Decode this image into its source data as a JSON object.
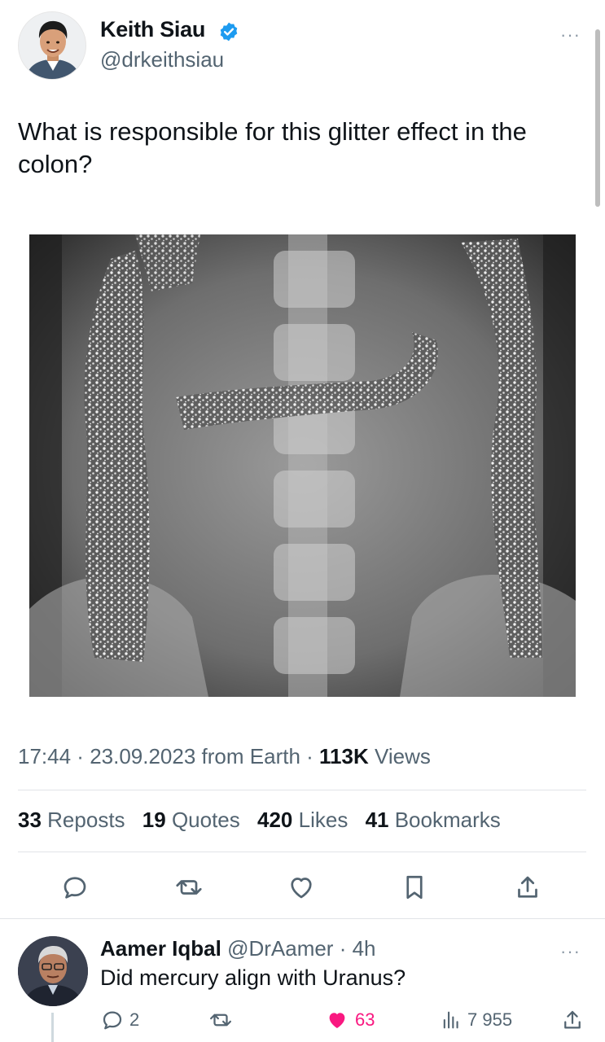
{
  "tweet": {
    "author": {
      "name": "Keith Siau",
      "handle": "@drkeithsiau",
      "verified_color": "#1d9bf0",
      "avatar_icon": "avatar-photo"
    },
    "more_label": "···",
    "text": "What is responsible for this glitter effect in the colon?",
    "media": {
      "kind": "abdominal-xray-image"
    },
    "meta": {
      "time": "17:44",
      "sep1": " · ",
      "date": "23.09.2023",
      "source": " from Earth",
      "sep2": " · ",
      "views_count": "113K",
      "views_label": " Views"
    },
    "stats": {
      "reposts_count": "33",
      "reposts_label": "Reposts",
      "quotes_count": "19",
      "quotes_label": "Quotes",
      "likes_count": "420",
      "likes_label": "Likes",
      "bookmarks_count": "41",
      "bookmarks_label": "Bookmarks"
    },
    "actions": [
      "reply-icon",
      "repost-icon",
      "like-icon",
      "bookmark-icon",
      "share-icon"
    ]
  },
  "reply": {
    "name": "Aamer Iqbal",
    "handle": "@DrAamer",
    "sep": " · ",
    "time": "4h",
    "more_label": "···",
    "text": "Did mercury align with Uranus?",
    "replies": "2",
    "likes": "63",
    "views": "7 955",
    "like_color": "#f91880"
  },
  "colors": {
    "text_primary": "#0f1419",
    "text_secondary": "#536471",
    "accent": "#1d9bf0",
    "divider": "#e1e4e8"
  }
}
